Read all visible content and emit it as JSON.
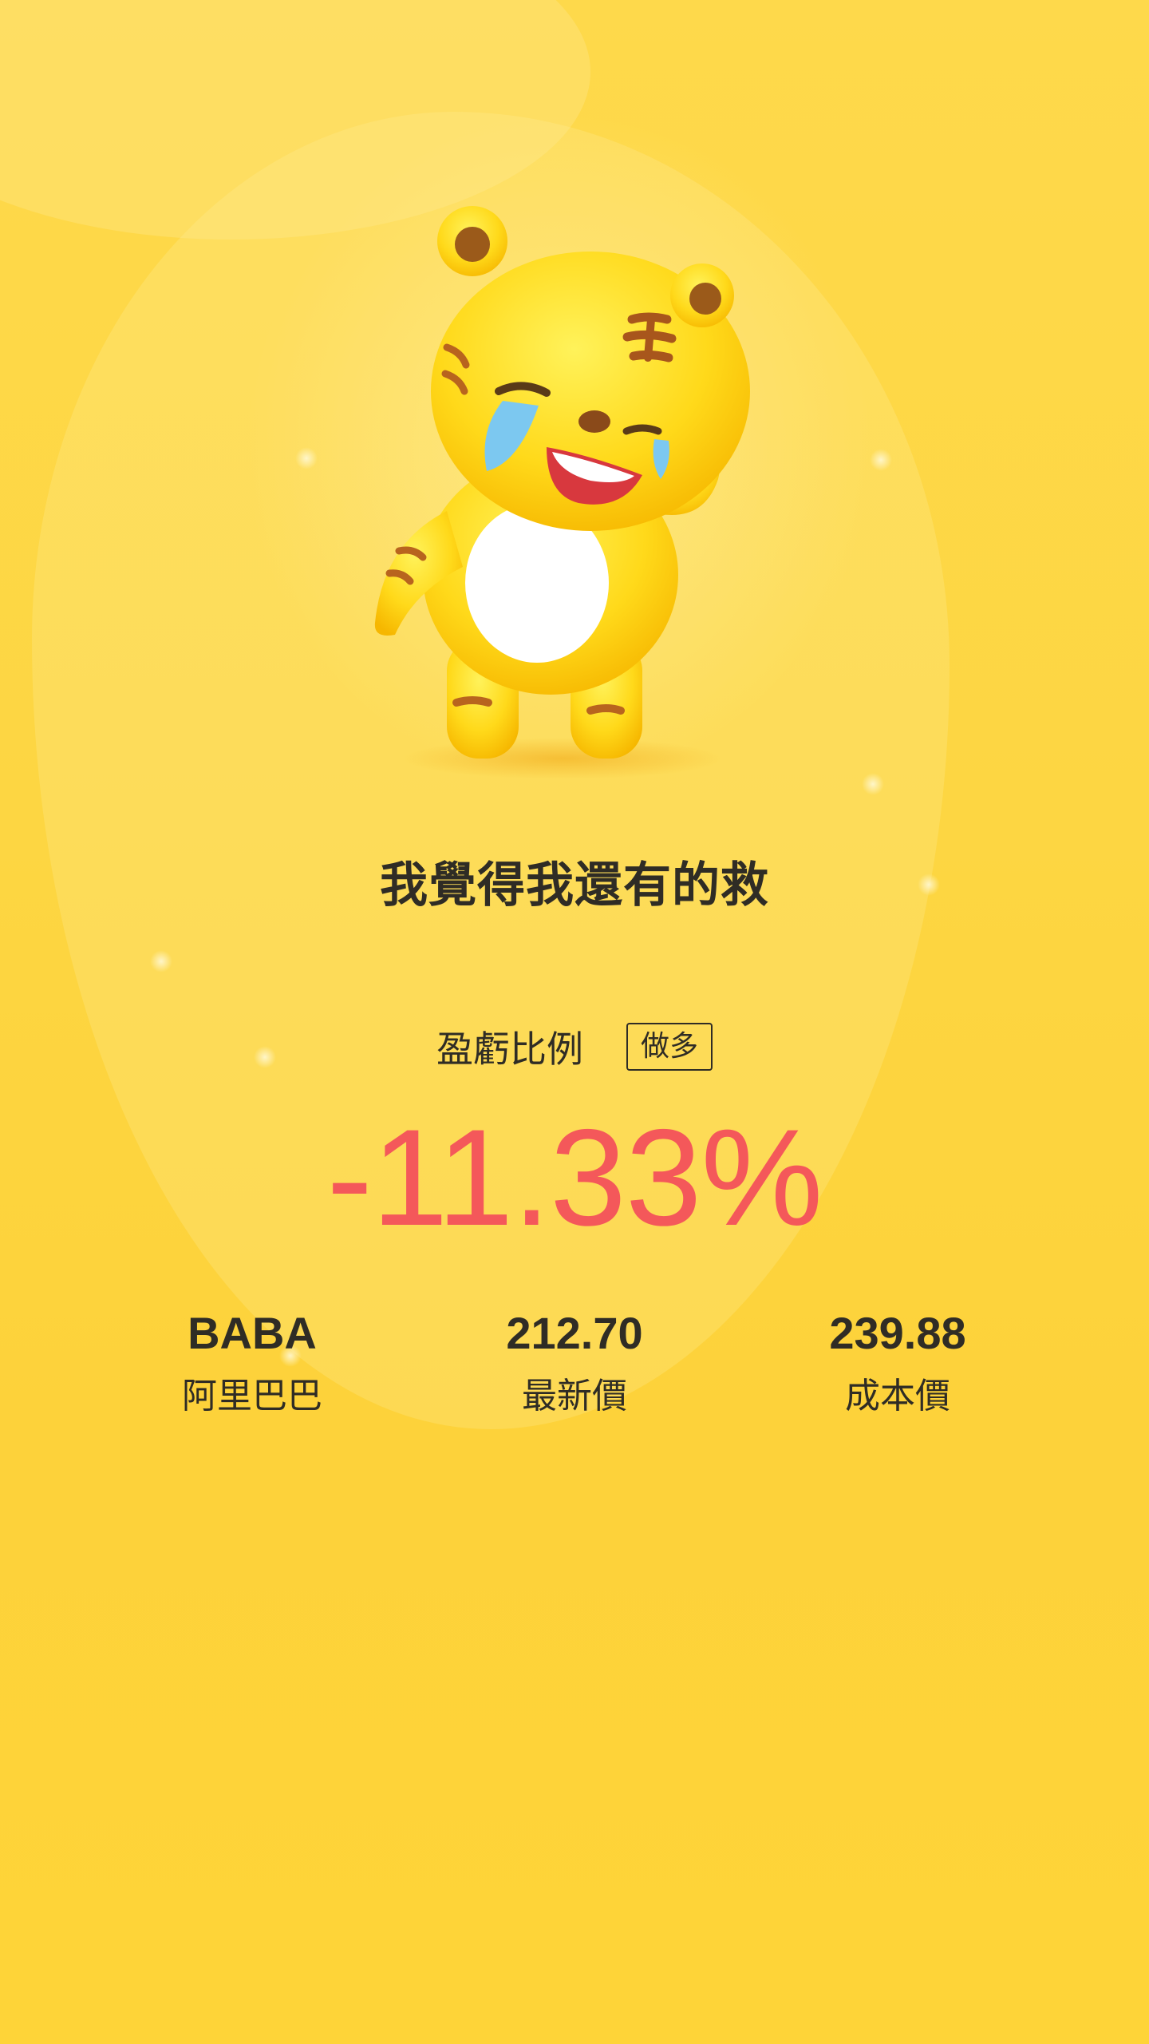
{
  "mascot": {
    "name": "crying-tiger-mascot"
  },
  "slogan": "我覺得我還有的救",
  "profit_loss": {
    "label": "盈虧比例",
    "direction_tag": "做多",
    "value": "-11.33%",
    "value_color": "#f4585a"
  },
  "stats": [
    {
      "value": "BABA",
      "label": "阿里巴巴"
    },
    {
      "value": "212.70",
      "label": "最新價"
    },
    {
      "value": "239.88",
      "label": "成本價"
    }
  ],
  "colors": {
    "background": "#fdd642",
    "text": "#2f2c25",
    "loss": "#f4585a"
  }
}
